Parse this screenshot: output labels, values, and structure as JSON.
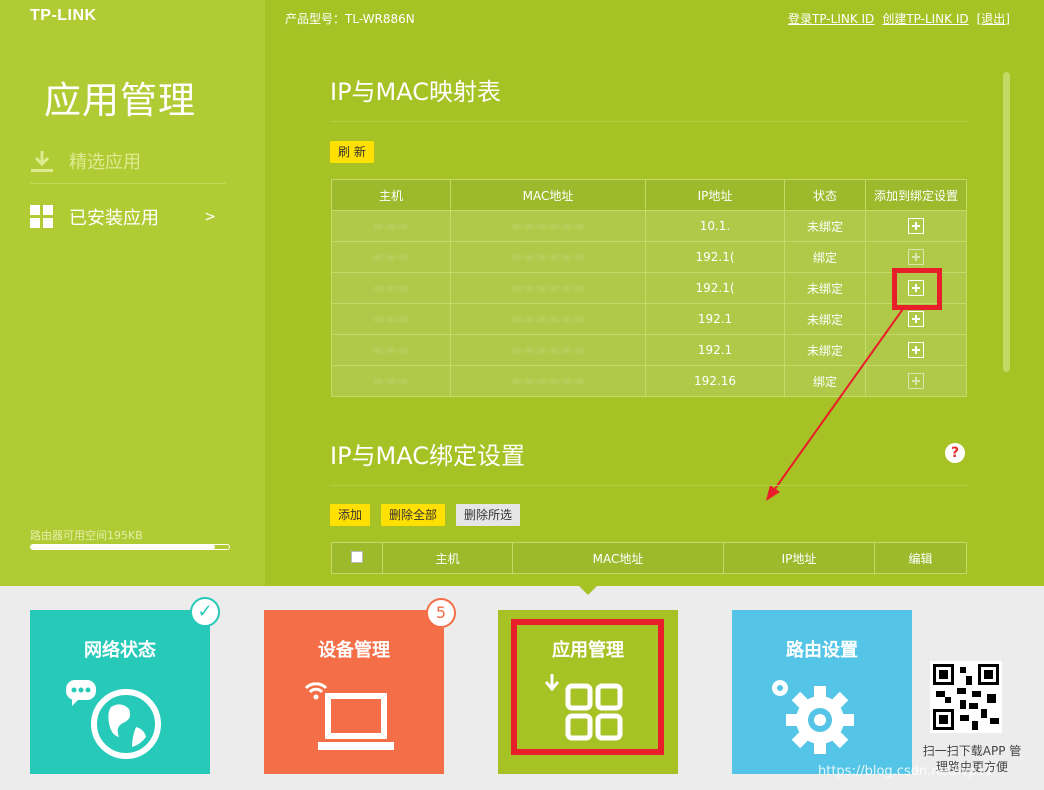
{
  "brand": {
    "logo": "TP-LINK"
  },
  "header": {
    "model": "产品型号：TL-WR886N",
    "login": "登录TP-LINK ID",
    "create": "创建TP-LINK ID",
    "logout": "[退出]"
  },
  "sidebar": {
    "title": "应用管理",
    "items": [
      {
        "label": "精选应用",
        "icon": "download-icon"
      },
      {
        "label": "已安装应用",
        "icon": "grid-icon",
        "chevron": ">"
      }
    ],
    "storage_label": "路由器可用空间195KB",
    "storage_fraction": 0.93
  },
  "arp_section": {
    "title": "IP与MAC映射表",
    "refresh": "刷 新",
    "columns": [
      "主机",
      "MAC地址",
      "IP地址",
      "状态",
      "添加到绑定设置"
    ],
    "rows": [
      {
        "host": "-- -- --",
        "mac": "-- -- -- -- -- --",
        "ip": "10.1.",
        "status": "未绑定"
      },
      {
        "host": "-- -- --",
        "mac": "-- -- -- -- -- --",
        "ip": "192.1(",
        "status": "绑定"
      },
      {
        "host": "-- -- --",
        "mac": "-- -- -- -- -- --",
        "ip": "192.1(",
        "status": "未绑定"
      },
      {
        "host": "-- -- --",
        "mac": "-- -- -- -- -- --",
        "ip": "192.1",
        "status": "未绑定"
      },
      {
        "host": "-- -- --",
        "mac": "-- -- -- -- -- --",
        "ip": "192.1",
        "status": "未绑定"
      },
      {
        "host": "-- -- --",
        "mac": "-- -- -- -- -- --",
        "ip": "192.16",
        "status": "绑定"
      }
    ]
  },
  "bind_section": {
    "title": "IP与MAC绑定设置",
    "add": "添加",
    "delete_all": "删除全部",
    "delete_selected": "删除所选",
    "columns": [
      "主机",
      "MAC地址",
      "IP地址",
      "编辑"
    ]
  },
  "tiles": [
    {
      "label": "网络状态",
      "color": "#27c9b8"
    },
    {
      "label": "设备管理",
      "color": "#f46e47",
      "badge": "5"
    },
    {
      "label": "应用管理",
      "color": "#a6c224"
    },
    {
      "label": "路由设置",
      "color": "#54c5e7"
    }
  ],
  "qr_text": "扫一扫下载APP 管理路由更方便",
  "watermark": "https://blog.csdn.net/lvp11"
}
